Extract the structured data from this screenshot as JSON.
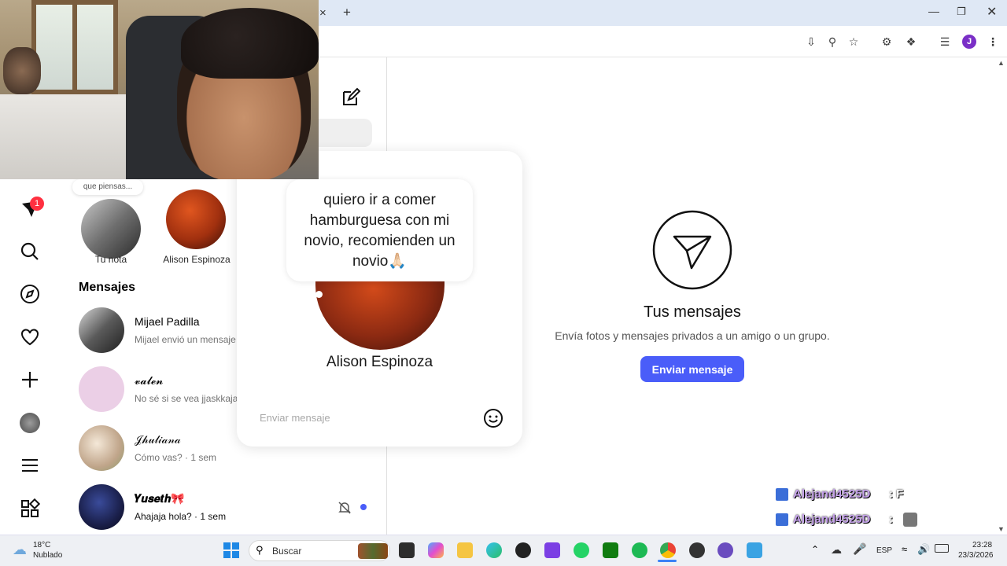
{
  "browser": {
    "tab_close": "×",
    "new_tab": "+",
    "profile_initial": "J",
    "window_controls": [
      "minimize-icon",
      "restore-icon",
      "close-icon"
    ],
    "toolbar_icons": [
      "install-icon",
      "zoom-icon",
      "star-icon",
      "extension-icon",
      "puzzle-icon",
      "media-icon",
      "menu-dots-icon"
    ]
  },
  "rail": {
    "notification_count": "1",
    "items": [
      "messenger-icon",
      "search-icon",
      "explore-icon",
      "heart-icon",
      "create-icon",
      "profile-icon",
      "menu-icon",
      "apps-icon"
    ]
  },
  "notes": {
    "small_note": "que piensas...",
    "items": [
      {
        "label": "Tu nota"
      },
      {
        "label": "Alison Espinoza"
      }
    ]
  },
  "conversations": {
    "heading": "Mensajes",
    "items": [
      {
        "name": "Mijael Padilla",
        "preview": "Mijael envió un mensaje"
      },
      {
        "name": "𝓿𝓪𝓵𝓮𝓷",
        "preview": "No sé si se vea jjaskkaja"
      },
      {
        "name": "𝒥𝒽𝓊𝓁𝒾𝒶𝓃𝒶",
        "preview": "Cómo vas? · 1 sem"
      },
      {
        "name": "𝒀𝒖𝒔𝒆𝒕𝒉🎀",
        "preview": "Ahajaja hola? · 1 sem"
      }
    ]
  },
  "popup": {
    "note_text": "quiero ir a comer hamburguesa con mi novio, recomienden un novio🙏🏻",
    "name": "Alison Espinoza",
    "input_placeholder": "Enviar mensaje"
  },
  "main": {
    "title": "Tus mensajes",
    "subtitle": "Envía fotos y mensajes privados a un amigo o un grupo.",
    "button": "Enviar mensaje",
    "accent": "#4a5df9"
  },
  "chat_overlay": [
    {
      "user": "Alejand4525D",
      "message": ": F"
    },
    {
      "user": "Alejand4525D",
      "message": ":"
    }
  ],
  "taskbar": {
    "weather_temp": "18°C",
    "weather_desc": "Nublado",
    "search_placeholder": "Buscar",
    "language": "ESP",
    "time": "23:28",
    "date": "23/3/2026"
  }
}
